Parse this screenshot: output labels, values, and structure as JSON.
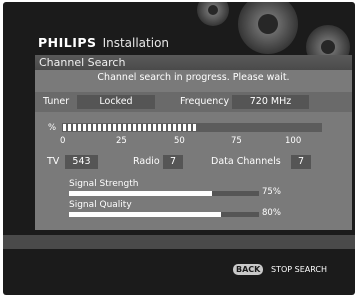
{
  "header": {
    "brand": "PHILIPS",
    "title": "Installation"
  },
  "screen_title": "Channel Search",
  "status": "Channel search in progress. Please wait.",
  "tuner": {
    "label": "Tuner",
    "value": "Locked"
  },
  "frequency": {
    "label": "Frequency",
    "value": "720 MHz"
  },
  "progress": {
    "symbol": "%",
    "percent": 52,
    "ticks": [
      "0",
      "25",
      "50",
      "75",
      "100"
    ]
  },
  "counts": {
    "tv_label": "TV",
    "tv_value": "543",
    "radio_label": "Radio",
    "radio_value": "7",
    "data_label": "Data Channels",
    "data_value": "7"
  },
  "signal_strength": {
    "label": "Signal Strength",
    "value": "75%",
    "fraction": 0.75
  },
  "signal_quality": {
    "label": "Signal Quality",
    "value": "80%",
    "fraction": 0.8
  },
  "footer": {
    "back_label": "BACK",
    "action_label": "STOP SEARCH"
  },
  "colors": {
    "panel": "#7a7a7a",
    "frame": "#1b1b1b",
    "title_bar": "#4f4f4f"
  }
}
